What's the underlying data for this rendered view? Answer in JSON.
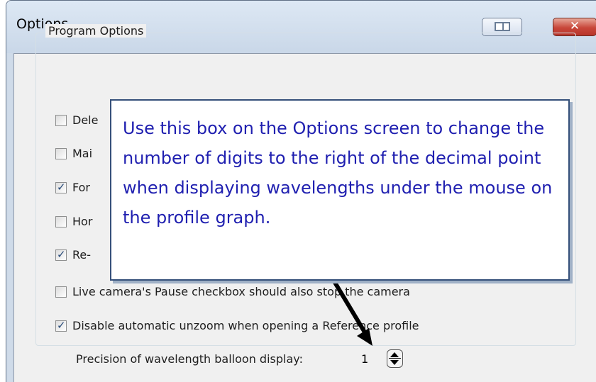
{
  "window": {
    "title": "Options",
    "close_glyph": "✕",
    "restore_icon": "restore-icon",
    "close_icon": "close-icon"
  },
  "group": {
    "legend": "Program Options",
    "checkboxes": [
      {
        "label": "Dele",
        "checked": false
      },
      {
        "label": "Mai",
        "checked": false
      },
      {
        "label": "For",
        "checked": true
      },
      {
        "label": "Hor",
        "checked": false
      },
      {
        "label": "Re-",
        "checked": true
      },
      {
        "label": "Live camera's Pause checkbox should also stop the camera",
        "checked": false
      },
      {
        "label": "Disable automatic unzoom when opening a Reference profile",
        "checked": true
      }
    ],
    "precision_label": "Precision of wavelength balloon display:",
    "precision_value": "1"
  },
  "callout": {
    "text": "Use this box on the Options screen to change the number of digits to the right of the decimal point when displaying wavelengths under the mouse on the profile graph."
  },
  "colors": {
    "callout_text": "#1f1fb0",
    "callout_border": "#35507a",
    "close_button": "#c8463a"
  }
}
